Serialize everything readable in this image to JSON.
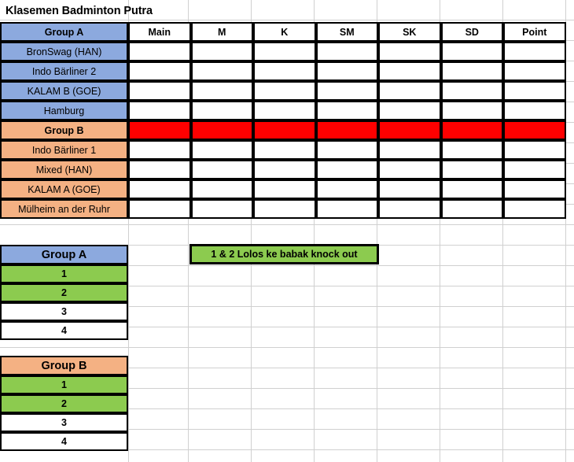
{
  "sheet": {
    "title": "Klasemen Badminton Putra"
  },
  "standings": {
    "columns": [
      "Main",
      "M",
      "K",
      "SM",
      "SK",
      "SD",
      "Point"
    ],
    "group_a": {
      "label": "Group A",
      "teams": [
        "BronSwag (HAN)",
        "Indo Bärliner 2",
        "KALAM B (GOE)",
        "Hamburg"
      ]
    },
    "group_b": {
      "label": "Group B",
      "teams": [
        "Indo Bärliner 1",
        "Mixed (HAN)",
        "KALAM A (GOE)",
        "Mülheim an der Ruhr"
      ]
    }
  },
  "rankings": {
    "group_a": {
      "label": "Group A",
      "positions": [
        "1",
        "2",
        "3",
        "4"
      ]
    },
    "group_b": {
      "label": "Group B",
      "positions": [
        "1",
        "2",
        "3",
        "4"
      ]
    }
  },
  "legend": {
    "note": "1 & 2 Lolos ke babak knock out"
  },
  "colors": {
    "group_a_fill": "#8CA9DE",
    "group_b_fill": "#F4B183",
    "qualified_fill": "#8CCB4F",
    "highlight_fill": "#FE0000"
  }
}
